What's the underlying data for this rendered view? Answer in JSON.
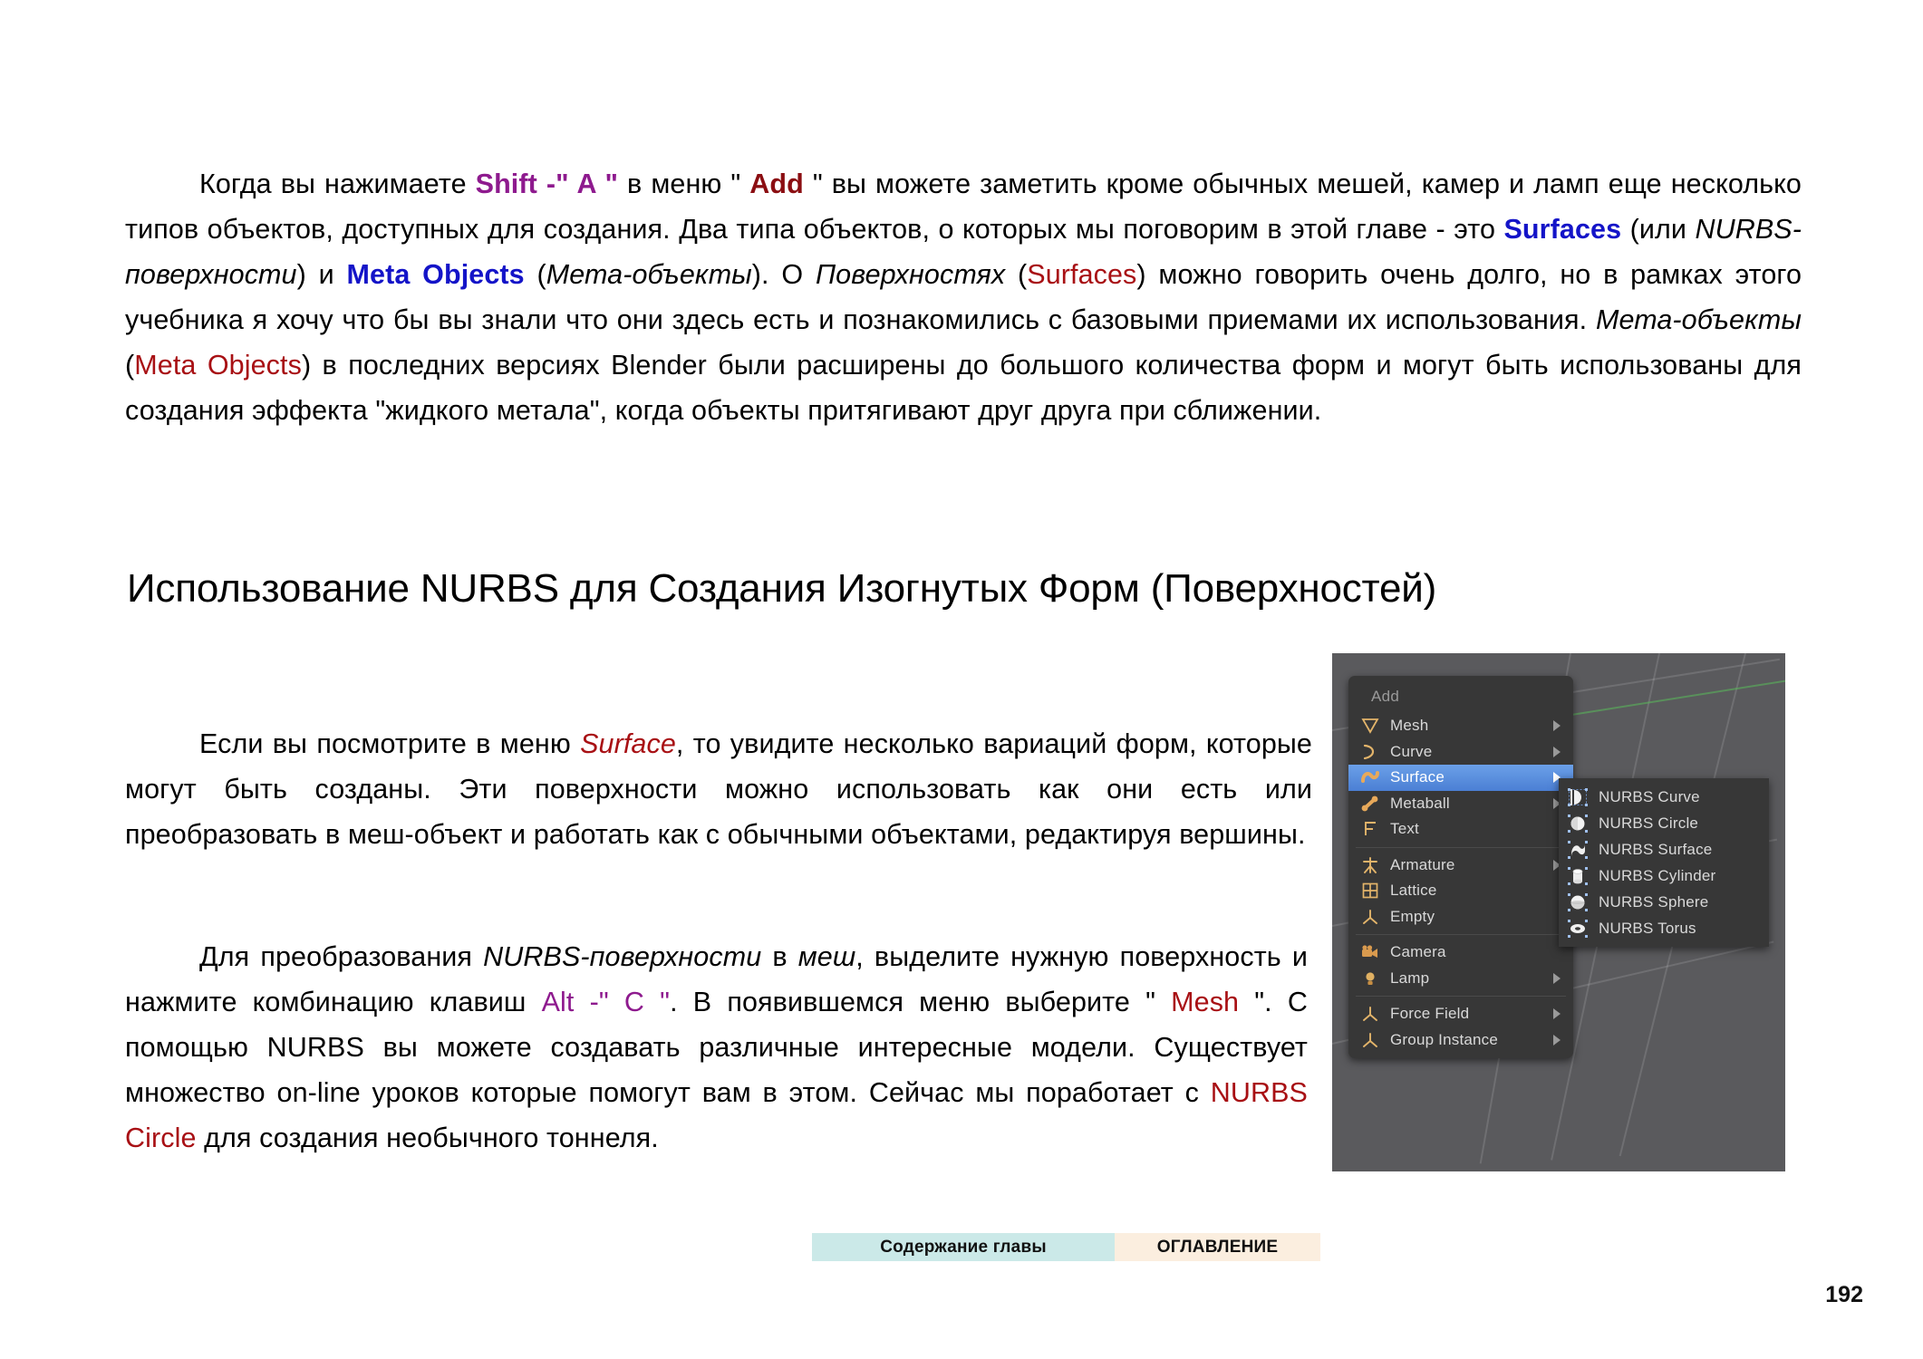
{
  "page": {
    "number": "192",
    "heading": "Использование NURBS для Создания Изогнутых Форм (Поверхностей)"
  },
  "paragraphs": {
    "intro": {
      "seg1": "Когда вы нажимаете ",
      "kw_shift": "Shift -\" A \"",
      "seg2": " в меню \" ",
      "kw_add": "Add",
      "seg3": " \" вы можете заметить кроме обычных мешей, камер и ламп еще несколько типов объектов, доступных для создания. Два типа объектов, о которых мы поговорим в этой главе - это ",
      "kw_surfaces": "Surfaces",
      "seg4": " (или ",
      "it_nurbs_poverhnosti": "NURBS-поверхности",
      "seg5": ") и ",
      "kw_meta_objects": "Meta Objects",
      "seg6": " (",
      "it_meta_obiekty": "Мета-объекты",
      "seg7": "). О ",
      "it_poverhnostyah": "Поверхностях",
      "seg8": " (",
      "red_surfaces": "Surfaces",
      "seg9": ") можно говорить очень долго, но в рамках этого учебника я хочу что бы вы знали что они здесь есть и познакомились с базовыми приемами их использования. ",
      "it_meta_obiekty2": "Мета-объекты",
      "seg10": " (",
      "red_meta_objects": "Meta Objects",
      "seg11": ") в последних версиях Blender были расширены до большого количества форм и могут быть использованы для создания эффекта \"жидкого метала\", когда объекты притягивают друг друга при сближении."
    },
    "surface1": {
      "seg1": "Если вы посмотрите в меню ",
      "it_surface": "Surface",
      "seg2": ", то увидите несколько вариаций форм, которые могут быть созданы. Эти поверхности можно использовать как они есть или преобразовать в меш-объект и работать как с обычными объектами, редактируя вершины."
    },
    "surface2": {
      "seg1": "Для преобразования ",
      "it_nurbs_poverhnosti": "NURBS-поверхности",
      "seg2": " в ",
      "it_mesh": "меш",
      "seg3": ", выделите нужную поверхность и нажмите комбинацию клавиш ",
      "kw_altc": "Alt -\" C \"",
      "seg4": ". В появившемся меню выберите \" ",
      "red_mesh": "Mesh",
      "seg5": " \". С помощью NURBS вы можете создавать различные интересные модели. Существует множество on-line уроков которые помогут вам в этом. Сейчас мы поработает с ",
      "red_nurbs_circle": "NURBS Circle",
      "seg6": " для создания необычного тоннеля."
    }
  },
  "blender_screenshot": {
    "menu_title": "Add",
    "menu_items": [
      {
        "label": "Mesh",
        "icon": "mesh-icon",
        "has_submenu": true,
        "selected": false
      },
      {
        "label": "Curve",
        "icon": "curve-icon",
        "has_submenu": true,
        "selected": false
      },
      {
        "label": "Surface",
        "icon": "surface-icon",
        "has_submenu": true,
        "selected": true
      },
      {
        "label": "Metaball",
        "icon": "metaball-icon",
        "has_submenu": true,
        "selected": false
      },
      {
        "label": "Text",
        "icon": "text-icon",
        "has_submenu": false,
        "selected": false
      },
      {
        "label": "Armature",
        "icon": "armature-icon",
        "has_submenu": true,
        "selected": false
      },
      {
        "label": "Lattice",
        "icon": "lattice-icon",
        "has_submenu": false,
        "selected": false
      },
      {
        "label": "Empty",
        "icon": "empty-icon",
        "has_submenu": false,
        "selected": false
      },
      {
        "label": "Camera",
        "icon": "camera-icon",
        "has_submenu": false,
        "selected": false
      },
      {
        "label": "Lamp",
        "icon": "lamp-icon",
        "has_submenu": true,
        "selected": false
      },
      {
        "label": "Force Field",
        "icon": "force-field-icon",
        "has_submenu": true,
        "selected": false
      },
      {
        "label": "Group Instance",
        "icon": "group-instance-icon",
        "has_submenu": true,
        "selected": false
      }
    ],
    "submenu_items": [
      {
        "label": "NURBS Curve",
        "icon": "nurbs-curve-icon"
      },
      {
        "label": "NURBS Circle",
        "icon": "nurbs-circle-icon"
      },
      {
        "label": "NURBS Surface",
        "icon": "nurbs-surface-icon"
      },
      {
        "label": "NURBS Cylinder",
        "icon": "nurbs-cylinder-icon"
      },
      {
        "label": "NURBS Sphere",
        "icon": "nurbs-sphere-icon"
      },
      {
        "label": "NURBS Torus",
        "icon": "nurbs-torus-icon"
      }
    ],
    "highlight_color": "#5b8ede",
    "menu_bg_color": "#373737",
    "viewport_bg_color": "#5a5a5d"
  },
  "footer": {
    "chapter_contents": "Содержание главы",
    "table_of_contents": "ОГЛАВЛЕНИЕ",
    "chapter_contents_color": "#cbe9e8",
    "table_of_contents_color": "#fbeedf"
  }
}
